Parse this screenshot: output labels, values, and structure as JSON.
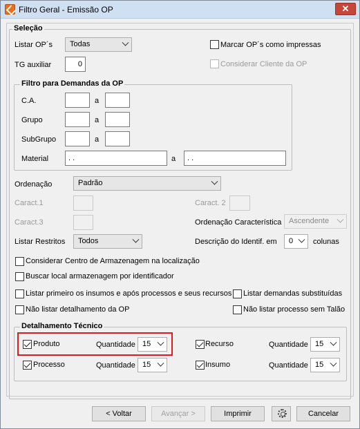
{
  "window": {
    "title": "Filtro Geral - Emissão OP",
    "close": "✕"
  },
  "selecao": {
    "legend": "Seleção",
    "listar_op_label": "Listar OP´s",
    "listar_op_value": "Todas",
    "tg_auxiliar_label": "TG auxiliar",
    "tg_auxiliar_value": "0",
    "marcar_impressas": "Marcar OP´s como impressas",
    "considerar_cliente": "Considerar Cliente da OP"
  },
  "filtro": {
    "legend": "Filtro para Demandas da OP",
    "ca_label": "C.A.",
    "grupo_label": "Grupo",
    "subgrupo_label": "SubGrupo",
    "material_label": "Material",
    "a_label": "a",
    "material_from": " .  .",
    "material_to": " .  ."
  },
  "ordenacao": {
    "label": "Ordenação",
    "value": "Padrão",
    "caract1_label": "Caract.1",
    "caract2_label": "Caract. 2",
    "caract3_label": "Caract.3",
    "ord_caract_label": "Ordenação Característica",
    "ord_caract_value": "Ascendente"
  },
  "restritos": {
    "label": "Listar Restritos",
    "value": "Todos",
    "descricao_label": "Descrição do Identif. em",
    "colunas_value": "0",
    "colunas_label": "colunas"
  },
  "options": {
    "centro_armazenagem": "Considerar Centro de Armazenagem na localização",
    "buscar_local": "Buscar local armazenagem por identificador",
    "listar_insumos": "Listar primeiro os insumos e após processos e seus recursos",
    "listar_substituidas": "Listar demandas substituídas",
    "nao_detalhamento": "Não listar detalhamento da OP",
    "nao_processo": "Não listar processo sem Talão"
  },
  "detalhamento": {
    "legend": "Detalhamento Técnico",
    "quantidade_label": "Quantidade",
    "produto": {
      "label": "Produto",
      "qty": "15"
    },
    "recurso": {
      "label": "Recurso",
      "qty": "15"
    },
    "processo": {
      "label": "Processo",
      "qty": "15"
    },
    "insumo": {
      "label": "Insumo",
      "qty": "15"
    }
  },
  "footer": {
    "voltar": "< Voltar",
    "avancar": "Avançar >",
    "imprimir": "Imprimir",
    "cancelar": "Cancelar"
  }
}
